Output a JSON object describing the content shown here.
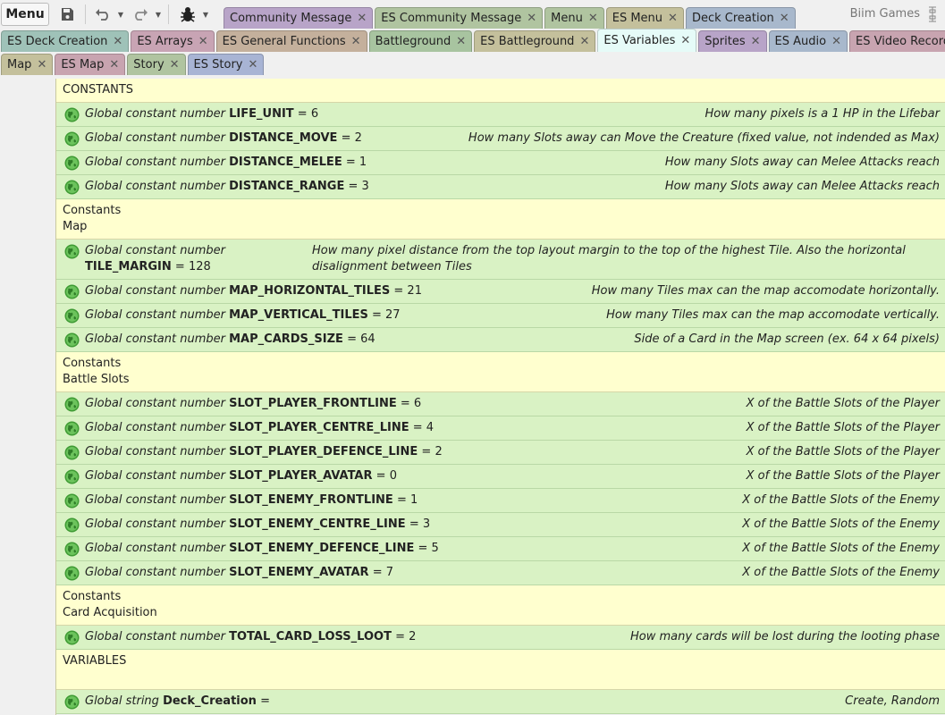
{
  "toolbar": {
    "menu_label": "Menu",
    "icons": [
      "save-icon",
      "undo-icon",
      "redo-icon",
      "debug-bug-icon",
      "fullscreen-icon"
    ],
    "brand": "Biim Games"
  },
  "tabs_row1": [
    {
      "label": "Community Message",
      "color": "#b8a4c8"
    },
    {
      "label": "ES Community Message",
      "color": "#b0c4a0"
    },
    {
      "label": "Menu",
      "color": "#b0c4a0"
    },
    {
      "label": "ES Menu",
      "color": "#c4c09c"
    },
    {
      "label": "Deck Creation",
      "color": "#a8b8cc"
    }
  ],
  "tabs_row2": [
    {
      "label": "ES Deck Creation",
      "color": "#9fc2b8"
    },
    {
      "label": "ES Arrays",
      "color": "#c8a4b4"
    },
    {
      "label": "ES General Functions",
      "color": "#c4b09c"
    },
    {
      "label": "Battleground",
      "color": "#a8c4a0"
    },
    {
      "label": "ES Battleground",
      "color": "#c4c09c"
    },
    {
      "label": "ES Variables",
      "color": "#e6fbf8",
      "active": true
    },
    {
      "label": "Sprites",
      "color": "#b8a4c8"
    },
    {
      "label": "ES Audio",
      "color": "#a8b8cc"
    },
    {
      "label": "ES Video Recording",
      "color": "#c8a4b0"
    }
  ],
  "tabs_row3": [
    {
      "label": "Map",
      "color": "#c4c09c"
    },
    {
      "label": "ES Map",
      "color": "#c8a4b0"
    },
    {
      "label": "Story",
      "color": "#b0c4a0"
    },
    {
      "label": "ES Story",
      "color": "#a8b4d4"
    }
  ],
  "events": [
    {
      "type": "group",
      "lines": [
        "CONSTANTS"
      ]
    },
    {
      "type": "var",
      "prefix": "Global constant number",
      "name": "LIFE_UNIT",
      "eq": "=",
      "value": "6",
      "desc": "How many pixels is a 1 HP in the Lifebar"
    },
    {
      "type": "var",
      "prefix": "Global constant number",
      "name": "DISTANCE_MOVE",
      "eq": "=",
      "value": "2",
      "desc": "How many Slots away can Move the Creature (fixed value, not indended as Max)"
    },
    {
      "type": "var",
      "prefix": "Global constant number",
      "name": "DISTANCE_MELEE",
      "eq": "=",
      "value": "1",
      "desc": "How many Slots away can Melee Attacks reach"
    },
    {
      "type": "var",
      "prefix": "Global constant number",
      "name": "DISTANCE_RANGE",
      "eq": "=",
      "value": "3",
      "desc": "How many Slots away can Melee Attacks reach"
    },
    {
      "type": "group",
      "lines": [
        "Constants",
        "Map"
      ]
    },
    {
      "type": "var",
      "wrap": true,
      "prefix": "Global constant number",
      "name": "TILE_MARGIN",
      "eq": "=",
      "value": "128",
      "desc": "How many pixel distance from the top layout margin to the top of the highest Tile. Also the horizontal disalignment between Tiles"
    },
    {
      "type": "var",
      "prefix": "Global constant number",
      "name": "MAP_HORIZONTAL_TILES",
      "eq": "=",
      "value": "21",
      "desc": "How many Tiles max can the map accomodate horizontally."
    },
    {
      "type": "var",
      "prefix": "Global constant number",
      "name": "MAP_VERTICAL_TILES",
      "eq": "=",
      "value": "27",
      "desc": "How many Tiles max can the map accomodate vertically."
    },
    {
      "type": "var",
      "prefix": "Global constant number",
      "name": "MAP_CARDS_SIZE",
      "eq": "=",
      "value": "64",
      "desc": "Side of a Card in the Map screen (ex. 64 x 64 pixels)"
    },
    {
      "type": "group",
      "lines": [
        "Constants",
        "Battle Slots"
      ]
    },
    {
      "type": "var",
      "prefix": "Global constant number",
      "name": "SLOT_PLAYER_FRONTLINE",
      "eq": "=",
      "value": "6",
      "desc": "X of the Battle Slots of the Player"
    },
    {
      "type": "var",
      "prefix": "Global constant number",
      "name": "SLOT_PLAYER_CENTRE_LINE",
      "eq": "=",
      "value": "4",
      "desc": "X of the Battle Slots of the Player"
    },
    {
      "type": "var",
      "prefix": "Global constant number",
      "name": "SLOT_PLAYER_DEFENCE_LINE",
      "eq": "=",
      "value": "2",
      "desc": "X of the Battle Slots of the Player"
    },
    {
      "type": "var",
      "prefix": "Global constant number",
      "name": "SLOT_PLAYER_AVATAR",
      "eq": "=",
      "value": "0",
      "desc": "X of the Battle Slots of the Player"
    },
    {
      "type": "var",
      "prefix": "Global constant number",
      "name": "SLOT_ENEMY_FRONTLINE",
      "eq": "=",
      "value": "1",
      "desc": "X of the Battle Slots of the Enemy"
    },
    {
      "type": "var",
      "prefix": "Global constant number",
      "name": "SLOT_ENEMY_CENTRE_LINE",
      "eq": "=",
      "value": "3",
      "desc": "X of the Battle Slots of the Enemy"
    },
    {
      "type": "var",
      "prefix": "Global constant number",
      "name": "SLOT_ENEMY_DEFENCE_LINE",
      "eq": "=",
      "value": "5",
      "desc": "X of the Battle Slots of the Enemy"
    },
    {
      "type": "var",
      "prefix": "Global constant number",
      "name": "SLOT_ENEMY_AVATAR",
      "eq": "=",
      "value": "7",
      "desc": "X of the Battle Slots of the Enemy"
    },
    {
      "type": "group",
      "lines": [
        "Constants",
        "Card Acquisition"
      ]
    },
    {
      "type": "var",
      "prefix": "Global constant number",
      "name": "TOTAL_CARD_LOSS_LOOT",
      "eq": "=",
      "value": "2",
      "desc": "How many cards will be lost during the looting phase"
    },
    {
      "type": "group",
      "lines": [
        "VARIABLES",
        ""
      ]
    },
    {
      "type": "var",
      "prefix": "Global string",
      "name": "Deck_Creation",
      "eq": "=",
      "value": "",
      "desc": "Create, Random"
    }
  ]
}
